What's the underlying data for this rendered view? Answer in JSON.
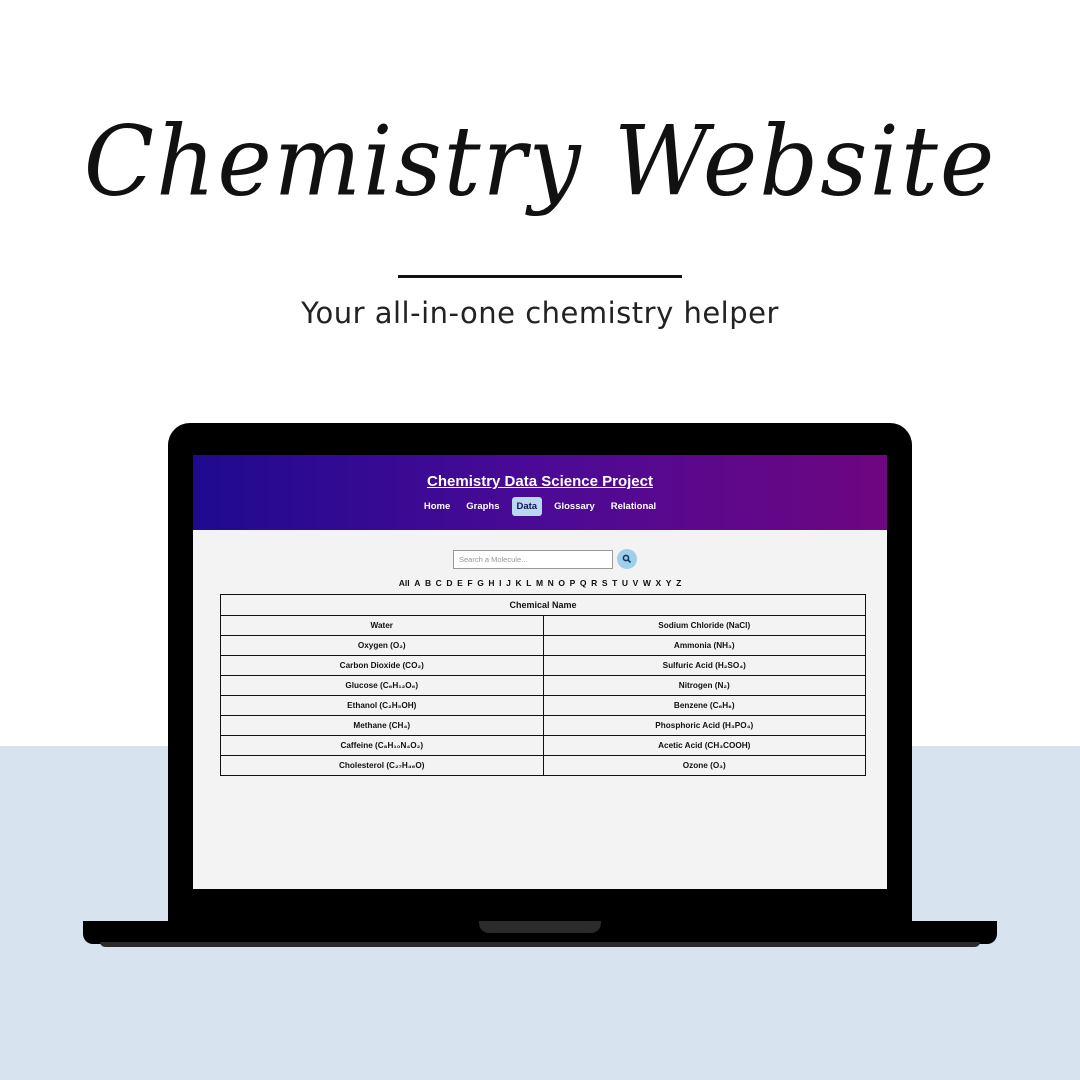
{
  "hero": {
    "title": "Chemistry Website",
    "subtitle": "Your all-in-one chemistry helper"
  },
  "site": {
    "title": "Chemistry Data Science Project",
    "nav": [
      {
        "label": "Home",
        "active": false
      },
      {
        "label": "Graphs",
        "active": false
      },
      {
        "label": "Data",
        "active": true
      },
      {
        "label": "Glossary",
        "active": false
      },
      {
        "label": "Relational",
        "active": false
      }
    ],
    "search": {
      "placeholder": "Search a Molecule...",
      "icon": "search-icon"
    },
    "alphabet": [
      "All",
      "A",
      "B",
      "C",
      "D",
      "E",
      "F",
      "G",
      "H",
      "I",
      "J",
      "K",
      "L",
      "M",
      "N",
      "O",
      "P",
      "Q",
      "R",
      "S",
      "T",
      "U",
      "V",
      "W",
      "X",
      "Y",
      "Z"
    ],
    "table": {
      "header": "Chemical Name",
      "rows": [
        [
          "Water",
          "Sodium Chloride (NaCl)"
        ],
        [
          "Oxygen (O₂)",
          "Ammonia (NH₃)"
        ],
        [
          "Carbon Dioxide (CO₂)",
          "Sulfuric Acid (H₂SO₄)"
        ],
        [
          "Glucose (C₆H₁₂O₆)",
          "Nitrogen (N₂)"
        ],
        [
          "Ethanol (C₂H₅OH)",
          "Benzene (C₆H₆)"
        ],
        [
          "Methane (CH₄)",
          "Phosphoric Acid (H₃PO₄)"
        ],
        [
          "Caffeine (C₈H₁₀N₄O₂)",
          "Acetic Acid (CH₃COOH)"
        ],
        [
          "Cholesterol (C₂₇H₄₆O)",
          "Ozone (O₃)"
        ]
      ]
    }
  },
  "colors": {
    "header_gradient_start": "#1f0a8f",
    "header_gradient_end": "#6e0680",
    "active_nav": "#b7d8ee",
    "band": "#d7e3ef"
  }
}
